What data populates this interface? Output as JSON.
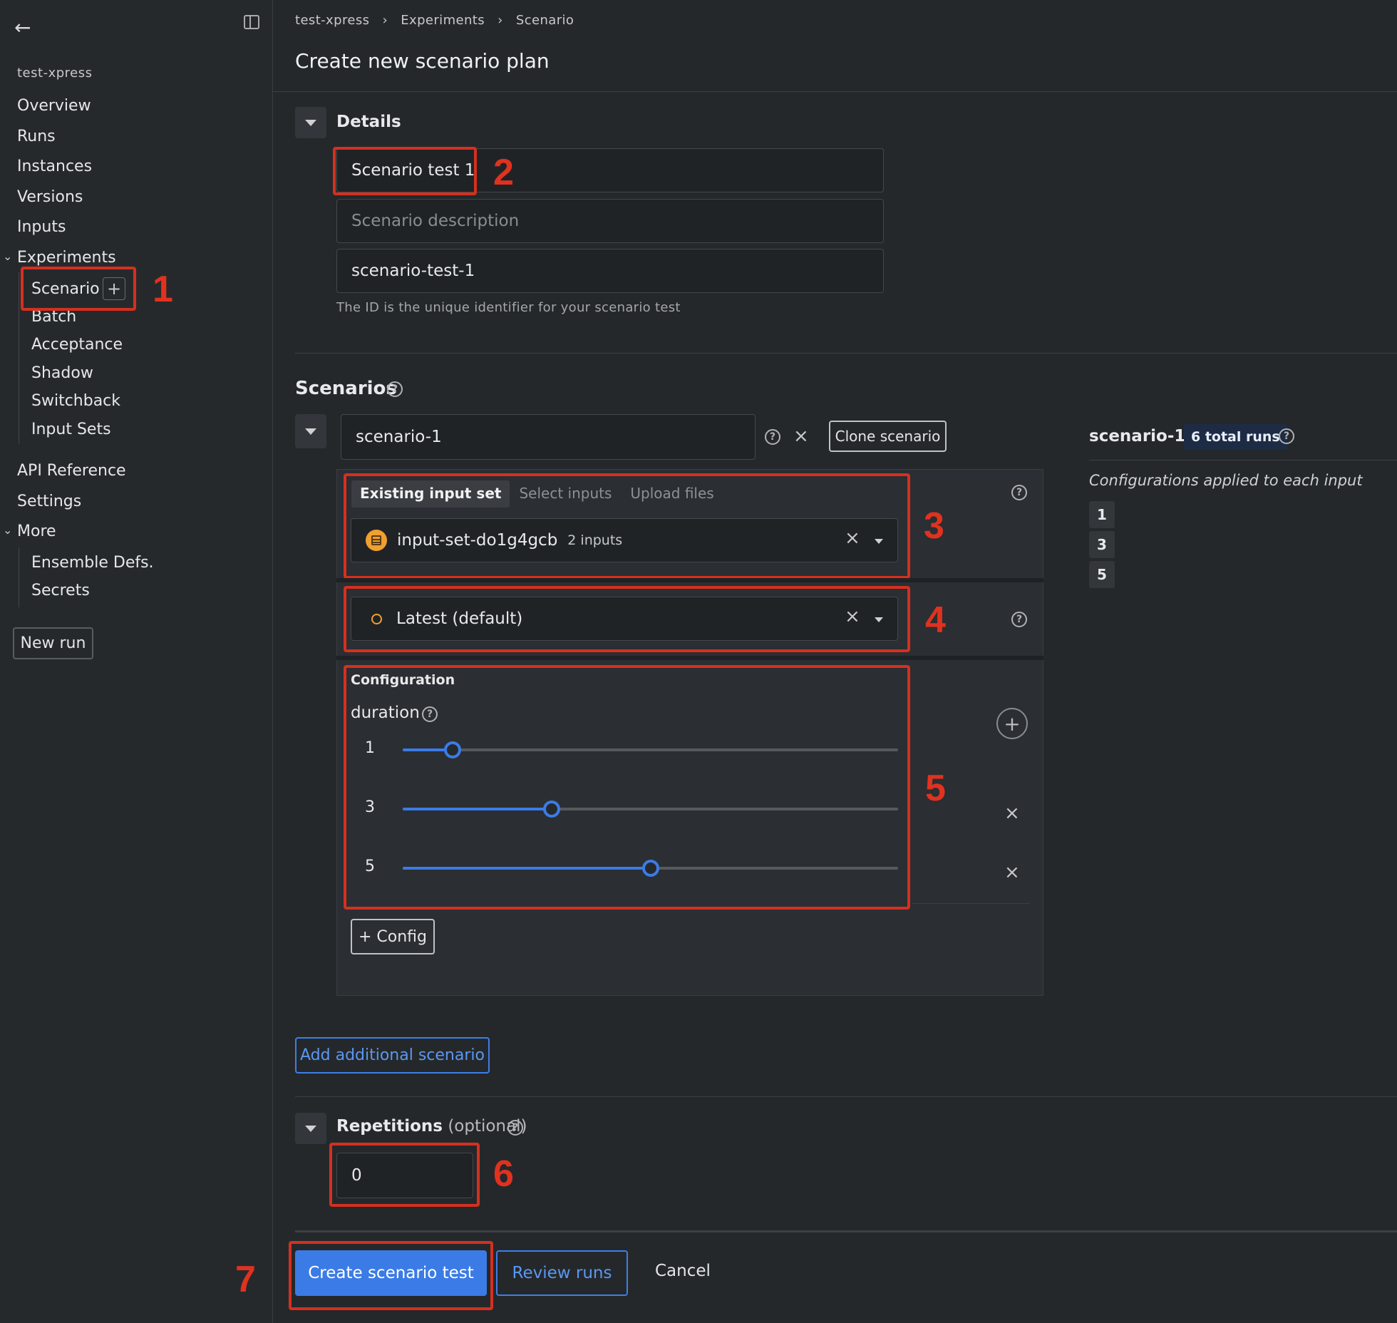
{
  "sidebar": {
    "project": "test-xpress",
    "items": [
      "Overview",
      "Runs",
      "Instances",
      "Versions",
      "Inputs"
    ],
    "experiments_label": "Experiments",
    "experiments": [
      "Scenario",
      "Batch",
      "Acceptance",
      "Shadow",
      "Switchback",
      "Input Sets"
    ],
    "api_reference": "API Reference",
    "settings": "Settings",
    "more_label": "More",
    "more": [
      "Ensemble Defs.",
      "Secrets"
    ],
    "new_run": "New run"
  },
  "breadcrumb": [
    "test-xpress",
    "Experiments",
    "Scenario"
  ],
  "page_title": "Create new scenario plan",
  "details": {
    "heading": "Details",
    "name_value": "Scenario test 1",
    "description_placeholder": "Scenario description",
    "id_value": "scenario-test-1",
    "id_hint": "The ID is the unique identifier for your scenario test"
  },
  "scenarios": {
    "heading": "Scenarios",
    "scenario_name": "scenario-1",
    "clone_label": "Clone scenario",
    "input_tabs": [
      "Existing input set",
      "Select inputs",
      "Upload files"
    ],
    "input_set_name": "input-set-do1g4gcb",
    "input_set_count": "2 inputs",
    "version_value": "Latest (default)",
    "config_heading": "Configuration",
    "param_name": "duration",
    "slider_values": [
      "1",
      "3",
      "5"
    ],
    "slider_levels": [
      0.1,
      0.3,
      0.5
    ],
    "add_config": "+ Config",
    "add_scenario": "Add additional scenario"
  },
  "summary": {
    "name": "scenario-1",
    "total_runs": "6 total runs",
    "subtitle": "Configurations applied to each input",
    "configs": [
      "1",
      "3",
      "5"
    ]
  },
  "repetitions": {
    "label": "Repetitions",
    "optional": "(optional)",
    "value": "0"
  },
  "footer": {
    "create": "Create scenario test",
    "review": "Review runs",
    "cancel": "Cancel"
  },
  "annotations": [
    "1",
    "2",
    "3",
    "4",
    "5",
    "6",
    "7"
  ],
  "colors": {
    "accent": "#3b7be6",
    "annotation": "#d5301f",
    "input_set_icon": "#f0a030"
  }
}
